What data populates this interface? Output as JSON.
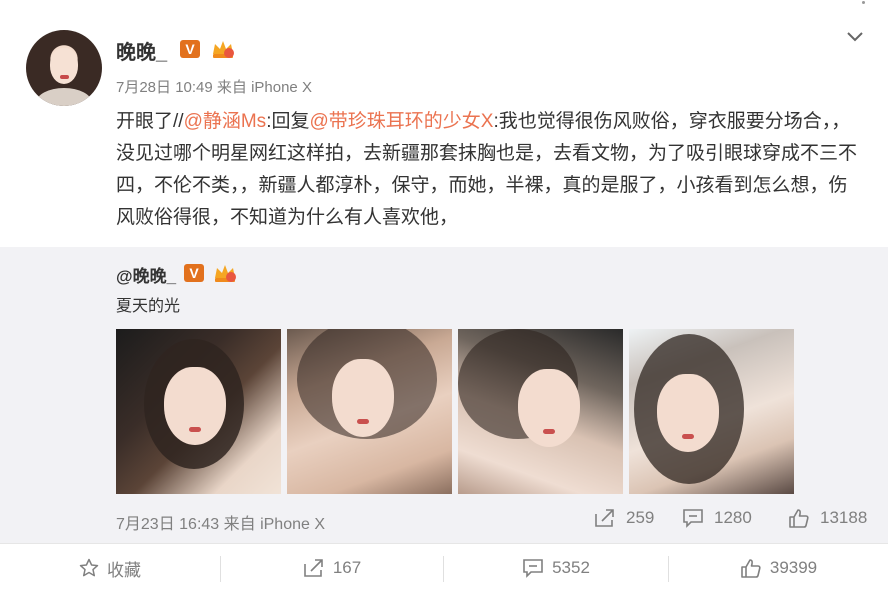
{
  "post": {
    "author": "晚晚_",
    "vip_badge": "V",
    "meta": "7月28日 10:49 来自 iPhone X",
    "text_segments": {
      "intro": "开眼了//",
      "mention1": "@静涵Ms",
      "reply_word": ":回复",
      "mention2": "@带珍珠耳环的少女X",
      "body": ":我也觉得很伤风败俗，穿衣服要分场合，，没见过哪个明星网红这样拍，去新疆那套抹胸也是，去看文物，为了吸引眼球穿成不三不四，不伦不类，，新疆人都淳朴，保守，而她，半裸，真的是服了，小孩看到怎么想，伤风败俗得很，不知道为什么有人喜欢他，"
    }
  },
  "repost": {
    "author": "@晚晚_",
    "vip_badge": "V",
    "text": "夏天的光",
    "meta": "7月23日 16:43 来自 iPhone X",
    "stats": {
      "shares": "259",
      "comments": "1280",
      "likes": "13188"
    }
  },
  "actions": {
    "favorite": "收藏",
    "forward": "167",
    "comment": "5352",
    "like": "39399"
  },
  "colors": {
    "accent": "#eb7350",
    "vip_badge": "#e2711d",
    "repost_bg": "#f2f2f5",
    "meta_gray": "#808080"
  }
}
